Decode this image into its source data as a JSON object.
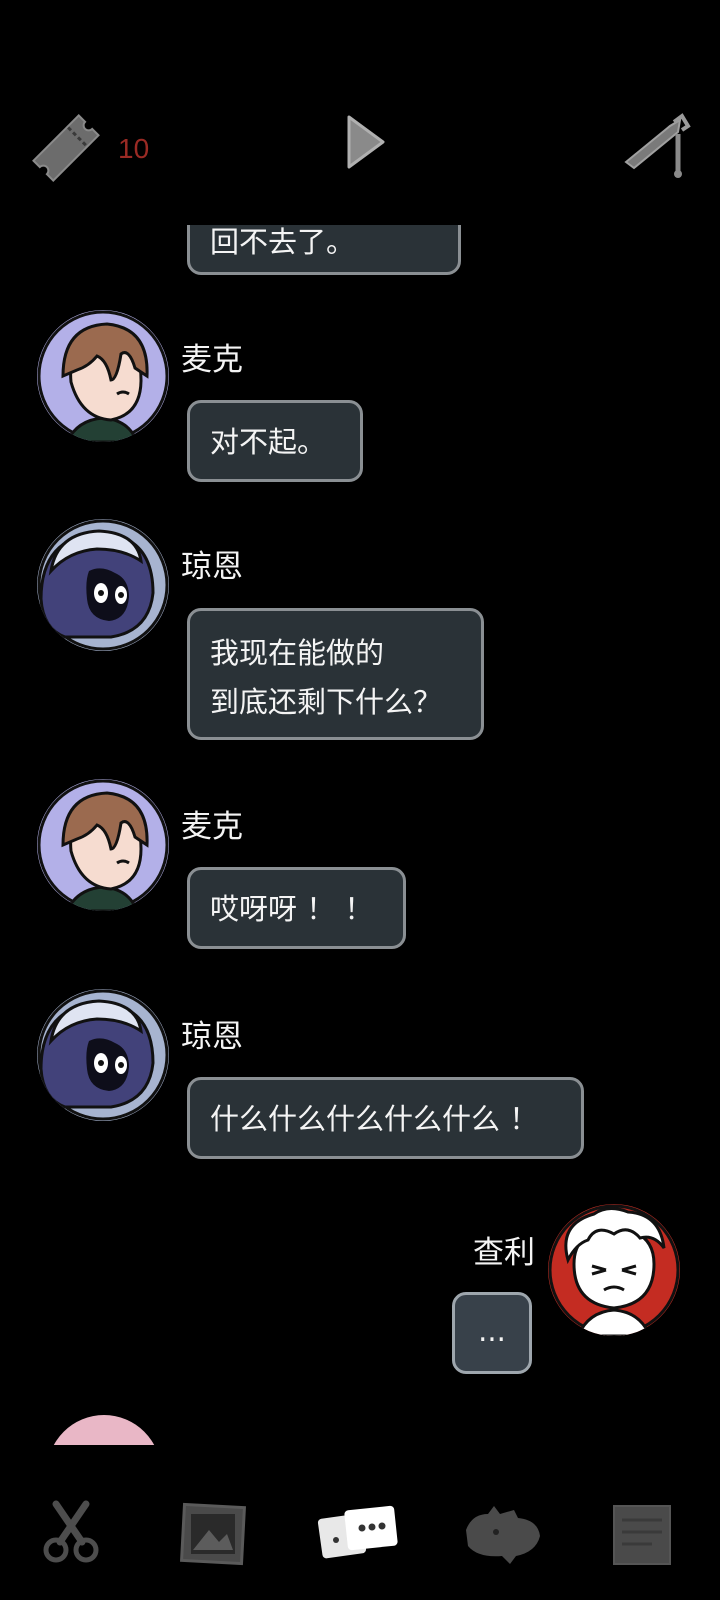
{
  "header": {
    "ticket_icon": "ticket-icon",
    "ticket_count": "10",
    "play_icon": "play-icon",
    "edit_icon": "pen-icon"
  },
  "chat": {
    "messages": [
      {
        "speaker": "",
        "lines": [
          "回不去了。"
        ],
        "side": "left"
      },
      {
        "speaker": "麦克",
        "avatar": "mike-avatar",
        "lines": [
          "对不起。"
        ],
        "side": "left"
      },
      {
        "speaker": "琼恩",
        "avatar": "joan-avatar",
        "lines": [
          "我现在能做的",
          "到底还剩下什么？"
        ],
        "side": "left"
      },
      {
        "speaker": "麦克",
        "avatar": "mike-avatar",
        "lines": [
          "哎呀呀 ！ ！"
        ],
        "side": "left"
      },
      {
        "speaker": "琼恩",
        "avatar": "joan-avatar",
        "lines": [
          "什么什么什么什么什么 ！"
        ],
        "side": "left"
      },
      {
        "speaker": "查利",
        "avatar": "charlie-avatar",
        "lines": [
          "..."
        ],
        "side": "right"
      }
    ]
  },
  "bottom_nav": {
    "items": [
      {
        "icon": "scissors-icon"
      },
      {
        "icon": "gallery-icon"
      },
      {
        "icon": "chat-cards-icon",
        "active": true
      },
      {
        "icon": "creature-icon"
      },
      {
        "icon": "notes-icon"
      }
    ]
  },
  "colors": {
    "background": "#000000",
    "bubble": "#2a3237",
    "bubble_border": "#8a8f93",
    "ticket_count": "#9a2a24",
    "mike_avatar_bg": "#b3b0e8",
    "joan_avatar_bg": "#a7b4d0",
    "charlie_avatar_bg": "#c42c22"
  }
}
